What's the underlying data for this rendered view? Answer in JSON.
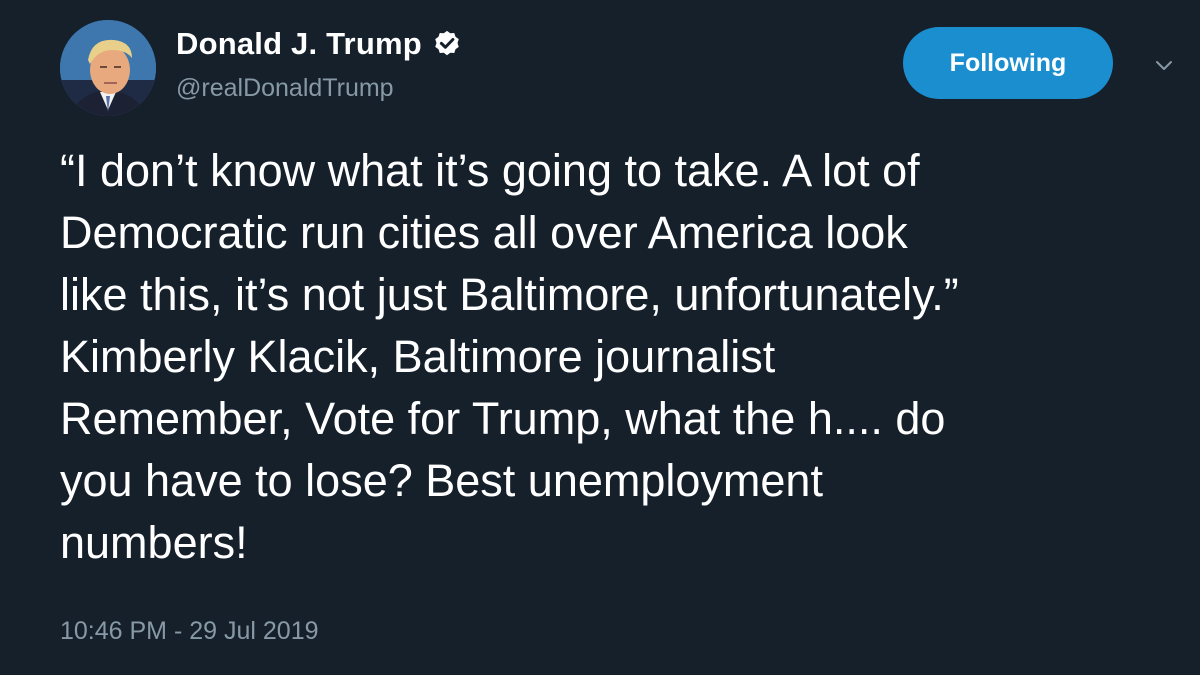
{
  "tweet": {
    "author": {
      "display_name": "Donald J. Trump",
      "handle": "@realDonaldTrump",
      "verified": true,
      "avatar_icon": "profile-photo"
    },
    "follow_button_label": "Following",
    "menu_icon": "chevron-down-icon",
    "text_lines": [
      "“I don’t know what it’s going to take. A lot of",
      "Democratic run cities all over America look",
      "like this, it’s not just Baltimore, unfortunately.”",
      "Kimberly Klacik, Baltimore journalist",
      "Remember, Vote for Trump, what the h.... do",
      "you have to lose? Best unemployment",
      "numbers!"
    ],
    "timestamp": "10:46 PM - 29 Jul 2019"
  },
  "colors": {
    "background": "#15202b",
    "text": "#ffffff",
    "secondary_text": "#8899a6",
    "accent": "#1b8ecf"
  }
}
